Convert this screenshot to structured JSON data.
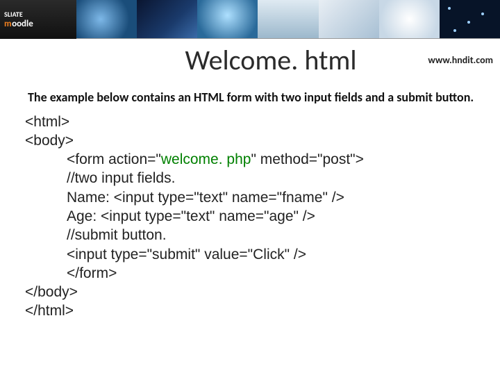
{
  "banner": {
    "logo_line1": "SLIATE",
    "logo_brand_a": "m",
    "logo_brand_b": "oodle"
  },
  "header": {
    "title": "Welcome. html",
    "url": "www.hndit.com"
  },
  "description": "The example below contains an HTML form with two input fields and a submit button.",
  "code": {
    "l1": "<html>",
    "l2": "<body>",
    "l3a": "<form action=\"",
    "l3b": "welcome. php",
    "l3c": "\" method=\"post\">",
    "l4": "//two input fields.",
    "l5": "Name: <input type=\"text\" name=\"fname\" />",
    "l6": "Age: <input type=\"text\" name=\"age\" />",
    "l7": "//submit button.",
    "l8": "<input type=\"submit\" value=\"Click\" />",
    "l9": "</form>",
    "l10": "</body>",
    "l11": "</html>"
  }
}
